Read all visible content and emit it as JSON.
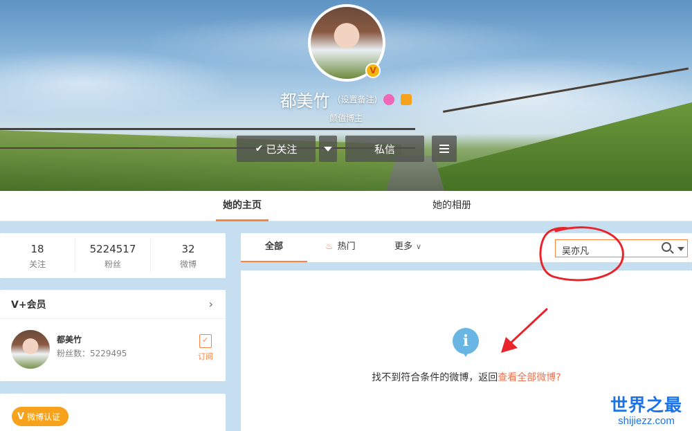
{
  "profile": {
    "name": "都美竹",
    "remark_link": "(设置备注)",
    "subtitle": "颜值博主",
    "verified_badge": "V"
  },
  "actions": {
    "follow_label": "已关注",
    "message_label": "私信"
  },
  "tabs": [
    {
      "label": "她的主页",
      "active": true
    },
    {
      "label": "她的相册",
      "active": false
    }
  ],
  "stats": [
    {
      "num": "18",
      "label": "关注"
    },
    {
      "num": "5224517",
      "label": "粉丝"
    },
    {
      "num": "32",
      "label": "微博"
    }
  ],
  "vplus": {
    "title": "V+会员",
    "chevron": "›",
    "name": "都美竹",
    "fans": "粉丝数：5229495",
    "subscribe_label": "订阅"
  },
  "verify": {
    "v": "V",
    "label": "微博认证"
  },
  "feed": {
    "tab_all": "全部",
    "tab_hot": "热门",
    "tab_more": "更多",
    "search_value": "吴亦凡",
    "empty_text": "找不到符合条件的微博，返回",
    "empty_link": "查看全部微博?"
  },
  "watermark": {
    "title": "世界之最",
    "url": "shijiezz.com"
  },
  "colors": {
    "accent": "#ff8140",
    "link": "#eb7350",
    "info": "#69b5e3",
    "annotation": "#e8242a",
    "watermark": "#1a73e8"
  }
}
